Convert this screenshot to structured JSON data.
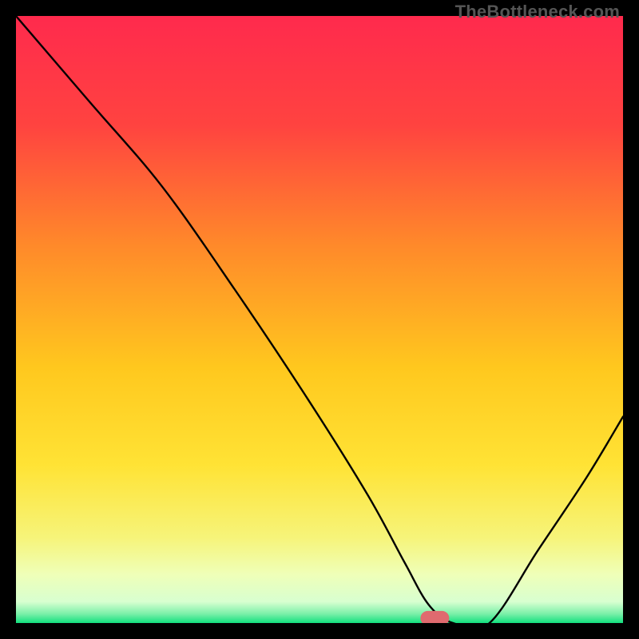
{
  "attribution": "TheBottleneck.com",
  "chart_data": {
    "type": "line",
    "title": "",
    "xlabel": "",
    "ylabel": "",
    "xlim": [
      0,
      100
    ],
    "ylim": [
      0,
      100
    ],
    "grid": false,
    "legend": false,
    "series": [
      {
        "name": "curve",
        "x": [
          0,
          12,
          24,
          36,
          48,
          58,
          64,
          68,
          72,
          78,
          86,
          94,
          100
        ],
        "y": [
          100,
          86,
          72,
          55,
          37,
          21,
          10,
          3,
          0,
          0,
          12,
          24,
          34
        ]
      }
    ],
    "marker": {
      "x": 69,
      "y": 0.8
    },
    "gradient_stops": [
      {
        "pos": 0.0,
        "color": "#ff2a4d"
      },
      {
        "pos": 0.18,
        "color": "#ff4340"
      },
      {
        "pos": 0.38,
        "color": "#ff8a2a"
      },
      {
        "pos": 0.58,
        "color": "#ffc81e"
      },
      {
        "pos": 0.74,
        "color": "#ffe335"
      },
      {
        "pos": 0.86,
        "color": "#f6f47a"
      },
      {
        "pos": 0.92,
        "color": "#efffb8"
      },
      {
        "pos": 0.965,
        "color": "#d8ffd0"
      },
      {
        "pos": 0.985,
        "color": "#7af0a8"
      },
      {
        "pos": 1.0,
        "color": "#12e07e"
      }
    ]
  }
}
